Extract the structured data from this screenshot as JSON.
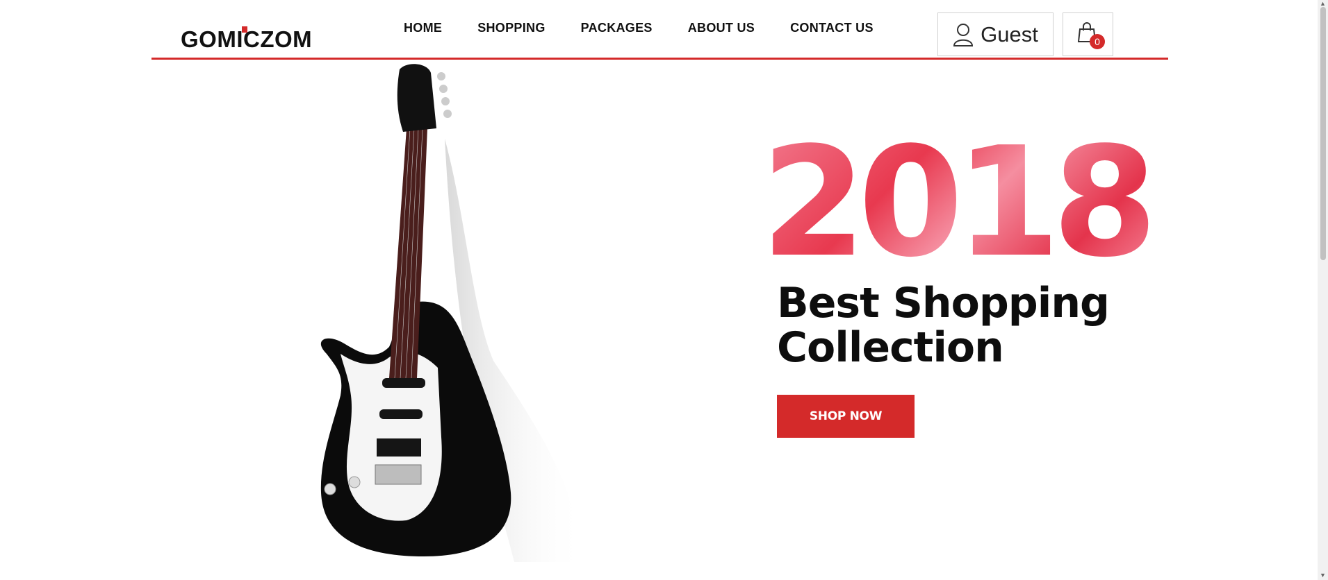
{
  "logo": {
    "text": "GOMICZOM"
  },
  "nav": {
    "home": "HOME",
    "shopping": "SHOPPING",
    "packages": "PACKAGES",
    "about": "ABOUT US",
    "contact": "CONTACT US"
  },
  "account": {
    "label": "Guest",
    "icon": "user-icon"
  },
  "cart": {
    "count": "0",
    "icon": "shopping-bag-icon"
  },
  "hero": {
    "year": "2018",
    "headline_line1": "Best Shopping",
    "headline_line2": "Collection",
    "cta": "SHOP NOW",
    "image": "electric-guitar-image"
  },
  "colors": {
    "accent": "#d42a2a",
    "year_pink": "#e8394f"
  }
}
